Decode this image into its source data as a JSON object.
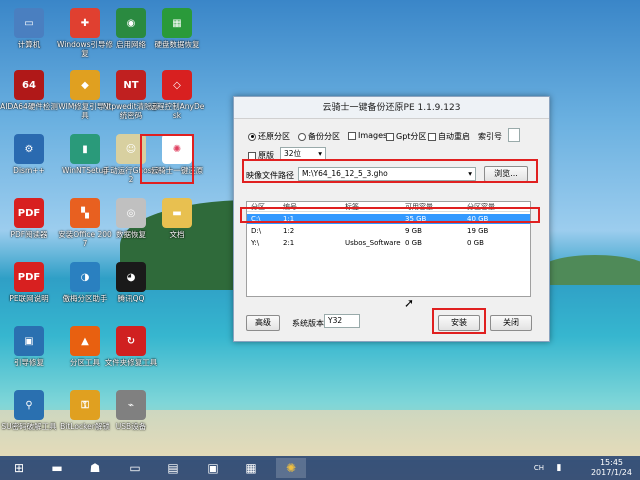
{
  "desktop": {
    "icons": [
      {
        "label": "计算机",
        "icon": "computer-icon",
        "color": "#4a7fc0",
        "glyph": "▭"
      },
      {
        "label": "Windows引导修复",
        "icon": "toolbox-icon",
        "color": "#e04030",
        "glyph": "✚"
      },
      {
        "label": "启用网络",
        "icon": "globe-icon",
        "color": "#2a8a40",
        "glyph": "◉"
      },
      {
        "label": "硬盘数据恢复",
        "icon": "disk-recovery-icon",
        "color": "#2a9a3a",
        "glyph": "▦"
      },
      {
        "label": "AIDA64硬件检测",
        "icon": "aida64-icon",
        "color": "#b01818",
        "glyph": "64"
      },
      {
        "label": "WIM修复引导工具",
        "icon": "wim-icon",
        "color": "#e0a020",
        "glyph": "◆"
      },
      {
        "label": "Ntpwedit清除系统密码",
        "icon": "ntpwedit-icon",
        "color": "#c02020",
        "glyph": "NT"
      },
      {
        "label": "远程控制AnyDesk",
        "icon": "anydesk-icon",
        "color": "#d82020",
        "glyph": "◇"
      },
      {
        "label": "Dism++",
        "icon": "gear-icon",
        "color": "#2a6ab0",
        "glyph": "⚙"
      },
      {
        "label": "WinNTSetup",
        "icon": "winntsetup-icon",
        "color": "#2a9a7a",
        "glyph": "▮"
      },
      {
        "label": "手动运行Ghost32",
        "icon": "ghost-icon",
        "color": "#d8d0a0",
        "glyph": "☺"
      },
      {
        "label": "云骑士一键还原",
        "icon": "yunqishi-icon",
        "color": "#ffffff",
        "glyph": "✺"
      },
      {
        "label": "PDF阅读器",
        "icon": "pdf-icon",
        "color": "#d82020",
        "glyph": "PDF"
      },
      {
        "label": "安装Office 2007",
        "icon": "office-icon",
        "color": "#e86020",
        "glyph": "▚"
      },
      {
        "label": "数据恢复",
        "icon": "data-recovery-icon",
        "color": "#c0c0c0",
        "glyph": "◎"
      },
      {
        "label": "文档",
        "icon": "folder-icon",
        "color": "#e8c050",
        "glyph": "▬"
      },
      {
        "label": "PE联网说明",
        "icon": "pdf-doc-icon",
        "color": "#d82020",
        "glyph": "PDF"
      },
      {
        "label": "傲梅分区助手",
        "icon": "partition-icon",
        "color": "#2a80c0",
        "glyph": "◑"
      },
      {
        "label": "腾讯QQ",
        "icon": "qq-icon",
        "color": "#1a1a1a",
        "glyph": "◕"
      },
      {
        "label": "引导修复",
        "icon": "boot-repair-icon",
        "color": "#2a70b0",
        "glyph": "▣"
      },
      {
        "label": "分区工具",
        "icon": "diskgenius-icon",
        "color": "#e86010",
        "glyph": "▲"
      },
      {
        "label": "文件夹修复工具",
        "icon": "repair-icon",
        "color": "#d02020",
        "glyph": "↻"
      },
      {
        "label": "SU密码破解工具",
        "icon": "password-icon",
        "color": "#2a70b0",
        "glyph": "⚲"
      },
      {
        "label": "BitLocker解锁",
        "icon": "bitlocker-icon",
        "color": "#e0a020",
        "glyph": "⚿"
      },
      {
        "label": "USB设备",
        "icon": "usb-icon",
        "color": "#808080",
        "glyph": "⌁"
      }
    ]
  },
  "window": {
    "title": "云骑士一键备份还原PE 1.1.9.123",
    "options": {
      "restore": "还原分区",
      "backup": "备份分区",
      "images": "Images",
      "gpt": "Gpt分区",
      "reboot": "自动重启",
      "index": "索引号",
      "original": "原版",
      "bits": "32位"
    },
    "image_path_label": "映像文件路径",
    "image_path": "M:\\Y64_16_12_5_3.gho",
    "browse": "浏览...",
    "table": {
      "headers": [
        "分区",
        "编号",
        "标签",
        "可用容量",
        "分区容量"
      ],
      "rows": [
        [
          "C:\\",
          "1:1",
          "",
          "35 GB",
          "40 GB"
        ],
        [
          "D:\\",
          "1:2",
          "",
          "9 GB",
          "19 GB"
        ],
        [
          "Y:\\",
          "2:1",
          "Usbos_Software",
          "0 GB",
          "0 GB"
        ]
      ]
    },
    "advanced": "高级",
    "sysver_label": "系统版本",
    "sysver": "Y32",
    "install": "安装",
    "close": "关闭"
  },
  "taskbar": {
    "time": "15:45",
    "date": "2017/1/24",
    "ime": "CH"
  }
}
